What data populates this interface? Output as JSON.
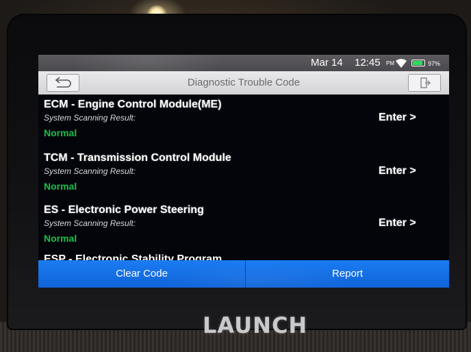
{
  "status_bar": {
    "date": "Mar 14",
    "time": "12:45",
    "ampm": "PM",
    "battery": "97%"
  },
  "title_bar": {
    "title": "Diagnostic Trouble Code"
  },
  "modules": [
    {
      "name": "ECM - Engine Control Module(ME)",
      "subtitle": "System Scanning Result:",
      "status": "Normal",
      "action": "Enter >"
    },
    {
      "name": "TCM - Transmission Control Module",
      "subtitle": "System Scanning Result:",
      "status": "Normal",
      "action": "Enter >"
    },
    {
      "name": "ES - Electronic Power Steering",
      "subtitle": "System Scanning Result:",
      "status": "Normal",
      "action": "Enter >"
    }
  ],
  "partial_module": {
    "name": "ESP - Electronic Stability Program"
  },
  "buttons": {
    "clear": "Clear Code",
    "report": "Report"
  },
  "device": {
    "brand": "LAUNCH"
  },
  "colors": {
    "accent": "#1b7cf2",
    "normal_status": "#18c04a",
    "screen_bg": "#04050a"
  }
}
